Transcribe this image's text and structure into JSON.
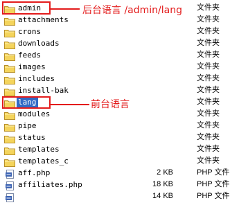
{
  "files": [
    {
      "name": "admin",
      "kind": "folder",
      "size": "",
      "type": "文件夹",
      "selected": false
    },
    {
      "name": "attachments",
      "kind": "folder",
      "size": "",
      "type": "文件夹",
      "selected": false
    },
    {
      "name": "crons",
      "kind": "folder",
      "size": "",
      "type": "文件夹",
      "selected": false
    },
    {
      "name": "downloads",
      "kind": "folder",
      "size": "",
      "type": "文件夹",
      "selected": false
    },
    {
      "name": "feeds",
      "kind": "folder",
      "size": "",
      "type": "文件夹",
      "selected": false
    },
    {
      "name": "images",
      "kind": "folder",
      "size": "",
      "type": "文件夹",
      "selected": false
    },
    {
      "name": "includes",
      "kind": "folder",
      "size": "",
      "type": "文件夹",
      "selected": false
    },
    {
      "name": "install-bak",
      "kind": "folder",
      "size": "",
      "type": "文件夹",
      "selected": false
    },
    {
      "name": "lang",
      "kind": "folder",
      "size": "",
      "type": "文件夹",
      "selected": true
    },
    {
      "name": "modules",
      "kind": "folder",
      "size": "",
      "type": "文件夹",
      "selected": false
    },
    {
      "name": "pipe",
      "kind": "folder",
      "size": "",
      "type": "文件夹",
      "selected": false
    },
    {
      "name": "status",
      "kind": "folder",
      "size": "",
      "type": "文件夹",
      "selected": false
    },
    {
      "name": "templates",
      "kind": "folder",
      "size": "",
      "type": "文件夹",
      "selected": false
    },
    {
      "name": "templates_c",
      "kind": "folder",
      "size": "",
      "type": "文件夹",
      "selected": false
    },
    {
      "name": "aff.php",
      "kind": "php",
      "size": "2 KB",
      "type": "PHP 文件",
      "selected": false
    },
    {
      "name": "affiliates.php",
      "kind": "php",
      "size": "18 KB",
      "type": "PHP 文件",
      "selected": false
    },
    {
      "name": "",
      "kind": "php",
      "size": "14 KB",
      "type": "PHP 文件",
      "selected": false
    }
  ],
  "annotations": {
    "admin_lang": "后台语言 /admin/lang",
    "front_lang": "前台语言"
  },
  "colors": {
    "annotation": "#e31b1b",
    "selection": "#316ac5",
    "folder": "#f4d45c"
  }
}
